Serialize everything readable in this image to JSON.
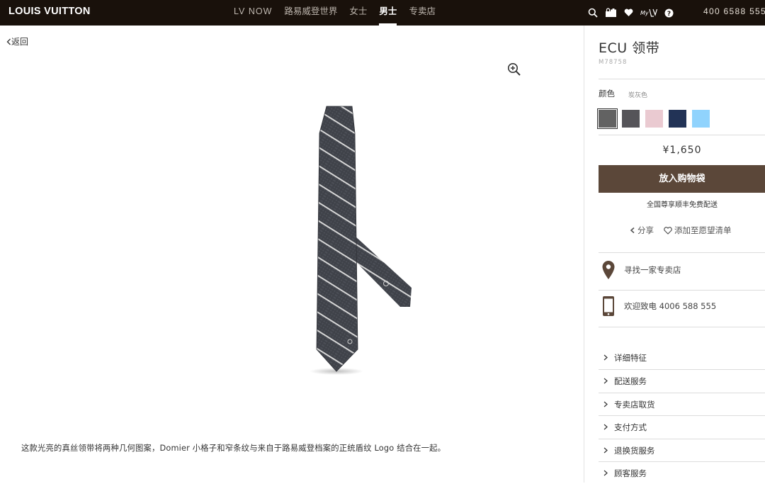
{
  "header": {
    "logo": "LOUIS VUITTON",
    "nav": [
      {
        "label": "LV NOW",
        "en": true,
        "active": false
      },
      {
        "label": "路易威登世界",
        "en": false,
        "active": false
      },
      {
        "label": "女士",
        "en": false,
        "active": false
      },
      {
        "label": "男士",
        "en": false,
        "active": true
      },
      {
        "label": "专卖店",
        "en": false,
        "active": false
      }
    ],
    "icons": [
      "search-icon",
      "shopping-bag-icon",
      "heart-icon",
      "my-lv-icon",
      "help-icon"
    ],
    "my_lv_label": "My",
    "phone": "400 6588 555"
  },
  "main": {
    "back_label": "返回",
    "description": "这款光亮的真丝领带将两种几何图案，Domier 小格子和窄条纹与来自于路易威登档案的正统盾纹 Logo 结合在一起。"
  },
  "product": {
    "title": "ECU 领带",
    "sku": "M78758",
    "color_label": "颜色",
    "color_value": "炭灰色",
    "swatches": [
      "#626262",
      "#555459",
      "#eacad1",
      "#223356",
      "#90d3fd"
    ],
    "selected_swatch": 0,
    "price": "¥1,650",
    "cart_label": "放入购物袋",
    "shipping_note": "全国尊享顺丰免费配送",
    "share_label": "分享",
    "wishlist_label": "添加至愿望清单",
    "store_finder": "寻找一家专卖店",
    "phone_contact": "欢迎致电 4006 588 555",
    "accordion": [
      "详细特征",
      "配送服务",
      "专卖店取货",
      "支付方式",
      "退换货服务",
      "顾客服务"
    ]
  },
  "colors": {
    "header_bg": "#19110b",
    "accent_brown": "#5b4739"
  }
}
